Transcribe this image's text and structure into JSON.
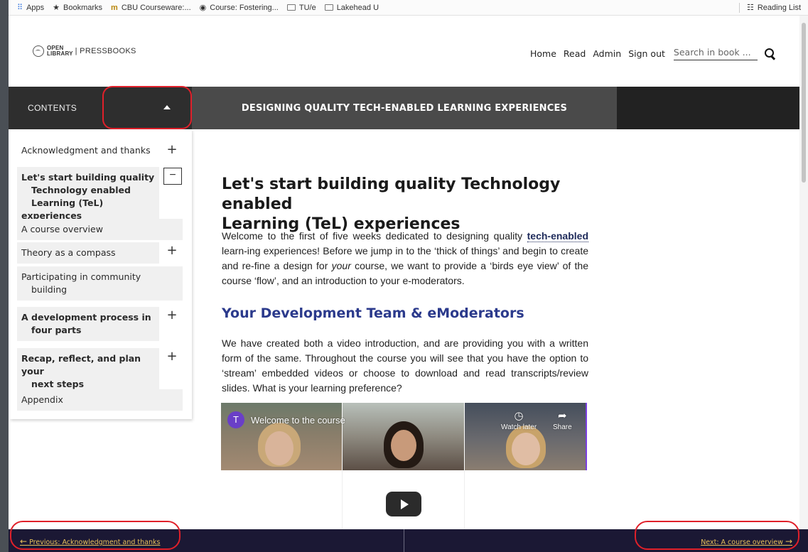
{
  "bookmarks": {
    "items": [
      {
        "label": "Apps",
        "icon": "apps-grid-icon"
      },
      {
        "label": "Bookmarks",
        "icon": "star-icon"
      },
      {
        "label": "CBU Courseware:...",
        "icon": "cbu-icon"
      },
      {
        "label": "Course: Fostering...",
        "icon": "globe-icon"
      },
      {
        "label": "TU/e",
        "icon": "folder-icon"
      },
      {
        "label": "Lakehead U",
        "icon": "folder-icon"
      }
    ],
    "reading_list": "Reading List"
  },
  "header": {
    "logo_open": "OPEN",
    "logo_library": "LIBRARY",
    "logo_pressbooks": "| PRESSBOOKS",
    "nav": [
      "Home",
      "Read",
      "Admin",
      "Sign out"
    ],
    "search_placeholder": "Search in book ..."
  },
  "contents_bar": {
    "label": "CONTENTS",
    "book_title": "DESIGNING QUALITY TECH-ENABLED LEARNING EXPERIENCES"
  },
  "toc": {
    "items": [
      {
        "label": "Acknowledgment and thanks",
        "control": "+"
      },
      {
        "label_lines": [
          "Let's start building quality",
          "Technology enabled",
          "Learning (TeL) experiences"
        ],
        "control": "−"
      },
      {
        "label": "A course overview"
      },
      {
        "label": "Theory as a compass",
        "control": "+"
      },
      {
        "label_lines": [
          "Participating in community",
          "building"
        ]
      },
      {
        "label_lines": [
          "A development process in",
          "four parts"
        ],
        "control": "+"
      },
      {
        "label_lines": [
          "Recap, reflect, and plan your",
          "next steps"
        ],
        "control": "+"
      },
      {
        "label": "Appendix"
      }
    ]
  },
  "main": {
    "title_line1": "Let's start building quality Technology enabled",
    "title_line2": "Learning (TeL) experiences",
    "intro_part1": "Welcome to the first of five weeks dedicated to designing quality ",
    "intro_link": "tech-enabled",
    "intro_part2": " learn-ing experiences! Before we jump in to the ‘thick of things’ and begin to create and re-fine a design for ",
    "intro_em": "your",
    "intro_part3": " course, we want to provide a ‘birds eye view’ of the course ‘flow’, and an introduction to your e-moderators.",
    "subheading": "Your Development Team & eModerators",
    "body": "We have created both a video introduction, and are providing you with a written form of the same. Throughout the course you will see that you have the option to ‘stream’ embedded videos or choose to download and read transcripts/review slides. What is your learning preference?"
  },
  "video": {
    "avatar_letter": "T",
    "title": "Welcome to the course",
    "watch_later": "Watch later",
    "share": "Share"
  },
  "bottom_nav": {
    "previous": "Previous: Acknowledgment and thanks",
    "next": "Next: A course overview"
  },
  "colors": {
    "annotation": "#e0202a",
    "subheading": "#2b3a8c",
    "bottom_nav_bg": "#1b1834",
    "bottom_nav_text": "#e8c15a"
  }
}
